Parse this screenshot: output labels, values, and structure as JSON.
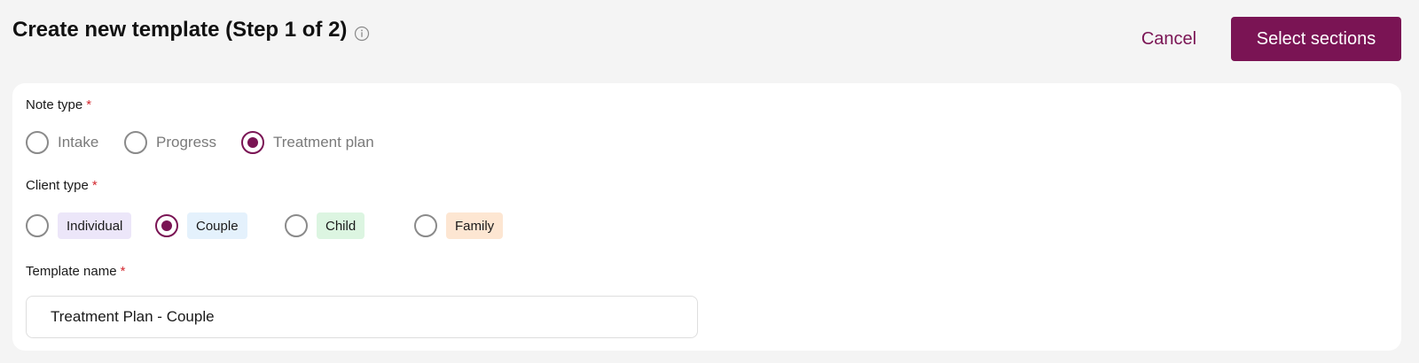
{
  "header": {
    "title": "Create new template (Step 1 of 2)",
    "cancel_label": "Cancel",
    "primary_label": "Select sections"
  },
  "form": {
    "required_marker": "*",
    "note_type": {
      "label": "Note type",
      "selected": "Treatment plan",
      "options": [
        "Intake",
        "Progress",
        "Treatment plan"
      ]
    },
    "client_type": {
      "label": "Client type",
      "selected": "Couple",
      "options": [
        {
          "label": "Individual",
          "color": "#ece6f9"
        },
        {
          "label": "Couple",
          "color": "#e4f1fc"
        },
        {
          "label": "Child",
          "color": "#dcf5e1"
        },
        {
          "label": "Family",
          "color": "#fde6d2"
        }
      ]
    },
    "template_name": {
      "label": "Template name",
      "value": "Treatment Plan - Couple"
    }
  },
  "colors": {
    "accent": "#7a1454",
    "required": "#d3282f",
    "background": "#f4f4f4"
  },
  "icons": {
    "title_info": "info-icon"
  }
}
